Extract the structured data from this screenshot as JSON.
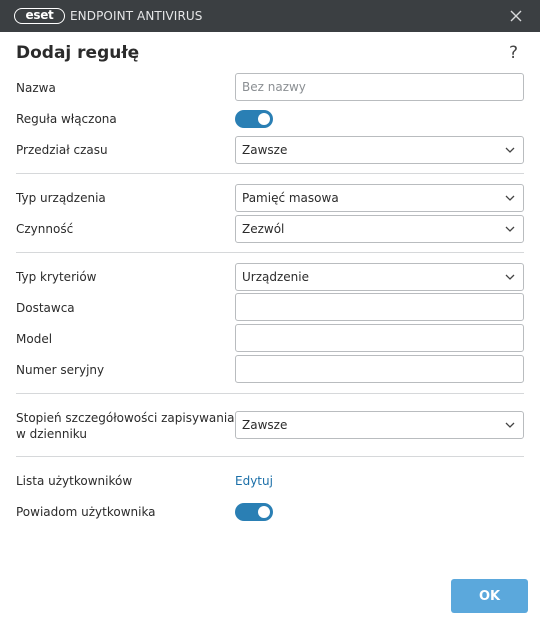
{
  "titlebar": {
    "logo_text": "eset",
    "product_name": "ENDPOINT ANTIVIRUS",
    "icons": {
      "close": "close-icon"
    }
  },
  "dialog": {
    "title": "Dodaj regułę",
    "help_symbol": "?"
  },
  "form": {
    "name": {
      "label": "Nazwa",
      "placeholder": "Bez nazwy",
      "value": ""
    },
    "rule_enabled": {
      "label": "Reguła włączona",
      "on": true
    },
    "time_slot": {
      "label": "Przedział czasu",
      "value": "Zawsze"
    },
    "device_type": {
      "label": "Typ urządzenia",
      "value": "Pamięć masowa"
    },
    "action": {
      "label": "Czynność",
      "value": "Zezwól"
    },
    "criteria_type": {
      "label": "Typ kryteriów",
      "value": "Urządzenie"
    },
    "vendor": {
      "label": "Dostawca",
      "value": ""
    },
    "model": {
      "label": "Model",
      "value": ""
    },
    "serial": {
      "label": "Numer seryjny",
      "value": ""
    },
    "logging": {
      "label_line1": "Stopień szczegółowości zapisywania",
      "label_line2": "w dzienniku",
      "value": "Zawsze"
    },
    "user_list": {
      "label": "Lista użytkowników",
      "link": "Edytuj"
    },
    "notify_user": {
      "label": "Powiadom użytkownika",
      "on": true
    }
  },
  "footer": {
    "ok_label": "OK"
  },
  "colors": {
    "titlebar_bg": "#3b3f42",
    "toggle_on": "#2a7fb4",
    "link": "#1b6fa8",
    "ok_button": "#5ba8dc"
  }
}
